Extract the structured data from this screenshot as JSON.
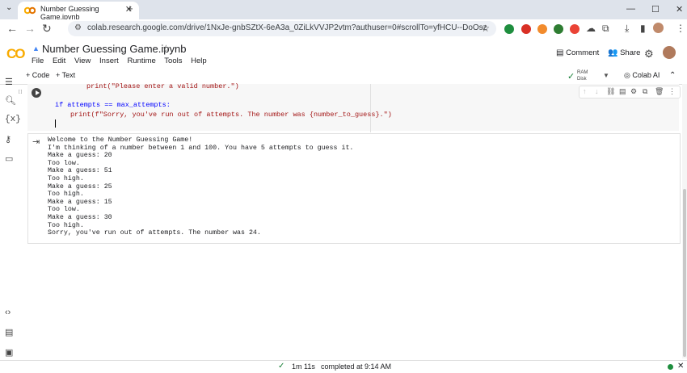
{
  "browser": {
    "tab_title": "Number Guessing Game.ipynb",
    "tab_close": "✕",
    "new_tab": "+",
    "url": "colab.research.google.com/drive/1NxJe-gnbSZtX-6eA3a_0ZiLkVVJP2vtm?authuser=0#scrollTo=yfHCU--DoOsz",
    "controls": {
      "minimize": "—",
      "maximize": "☐",
      "close": "✕"
    }
  },
  "colab": {
    "logo": "CO",
    "notebook_title": "Number Guessing Game.ipynb",
    "menu": [
      "File",
      "Edit",
      "View",
      "Insert",
      "Runtime",
      "Tools",
      "Help"
    ],
    "comment_label": "Comment",
    "share_label": "Share",
    "add_code_label": "+ Code",
    "add_text_label": "+ Text",
    "ram_label": "RAM",
    "disk_label": "Disk",
    "colab_ai_label": "Colab AI"
  },
  "cell": {
    "line_print_valid": "print(\"Please enter a valid number.\")",
    "line_if": "if attempts == max_attempts:",
    "line_print_sorry": "print(f\"Sorry, you've run out of attempts. The number was {number_to_guess}.\")"
  },
  "output": {
    "text": "Welcome to the Number Guessing Game!\nI'm thinking of a number between 1 and 100. You have 5 attempts to guess it.\nMake a guess: 20\nToo low.\nMake a guess: 51\nToo high.\nMake a guess: 25\nToo high.\nMake a guess: 15\nToo low.\nMake a guess: 30\nToo high.\nSorry, you've run out of attempts. The number was 24."
  },
  "status": {
    "duration": "1m 11s",
    "completed": "completed at 9:14 AM"
  },
  "colors": {
    "accent": "#f9ab00",
    "status_ok": "#1e8e3e",
    "tabstrip": "#dee3eb"
  }
}
